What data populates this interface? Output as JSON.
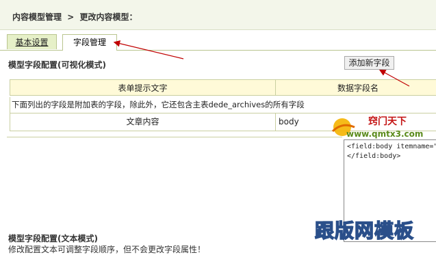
{
  "breadcrumb": [
    "内容模型管理",
    ">",
    "更改内容模型："
  ],
  "tabs": [
    {
      "label": "基本设置"
    },
    {
      "label": "字段管理"
    }
  ],
  "visual_section": {
    "title": "模型字段配置(可视化模式)",
    "add_button": "添加新字段",
    "columns": [
      "表单提示文字",
      "数据字段名"
    ],
    "note": "下面列出的字段是附加表的字段，除此外，它还包含主表dede_archives的所有字段",
    "rows": [
      {
        "label": "文章内容",
        "field": "body"
      }
    ]
  },
  "code_area": {
    "line1": "<field:body itemname=\"",
    "line2": "</field:body>"
  },
  "text_section": {
    "title": "模型字段配置(文本模式)",
    "hint": "修改配置文本可调整字段顺序，但不会更改字段属性！"
  },
  "watermarks": {
    "top_text": "窍门天下",
    "top_url": "www.qmtx3.com",
    "bottom_text": "跟版网模板"
  },
  "colors": {
    "header_bg": "#f3f6ea",
    "table_header_bg": "#fffad8",
    "annotation_red": "#c00000"
  }
}
